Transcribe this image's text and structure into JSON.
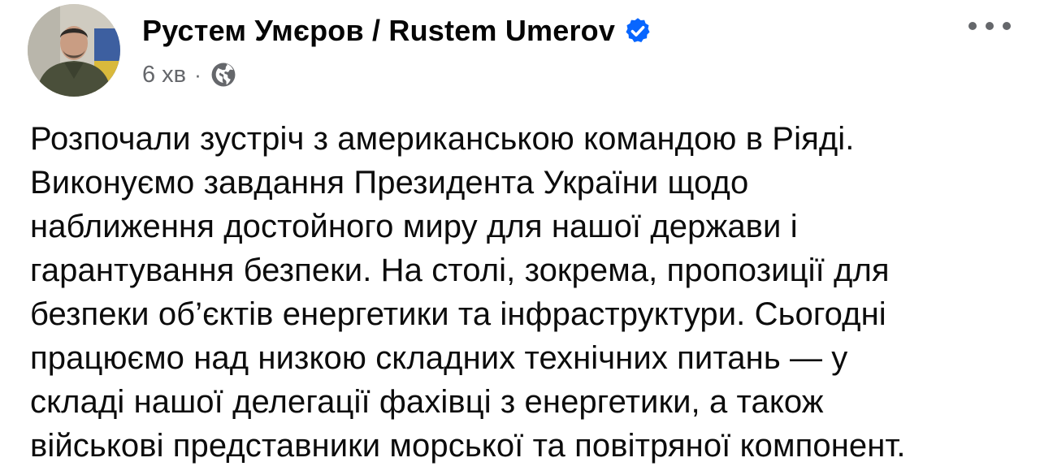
{
  "post": {
    "author": {
      "name": "Рустем Умєров / Rustem Umerov",
      "verified_icon": "verified-badge-icon",
      "avatar_icon": "profile-photo"
    },
    "meta": {
      "time": "6 хв",
      "separator": "·",
      "audience_icon": "globe-icon"
    },
    "more_icon": "more-options-icon",
    "text_lines": [
      "Розпочали зустріч з американською командою в Ріяді.",
      "Виконуємо завдання Президента України щодо",
      "наближення достойного миру для нашої держави і",
      "гарантування безпеки. На столі, зокрема, пропозиції для",
      "безпеки об’єктів енергетики та інфраструктури. Сьогодні",
      "працюємо над низкою складних технічних питань — у",
      "складі нашої делегації фахівці з енергетики, а також",
      "військові представники морської та повітряної компонент."
    ]
  },
  "colors": {
    "verified_blue": "#0866ff",
    "secondary_text": "#65676b",
    "primary_text": "#050505",
    "background": "#ffffff"
  }
}
